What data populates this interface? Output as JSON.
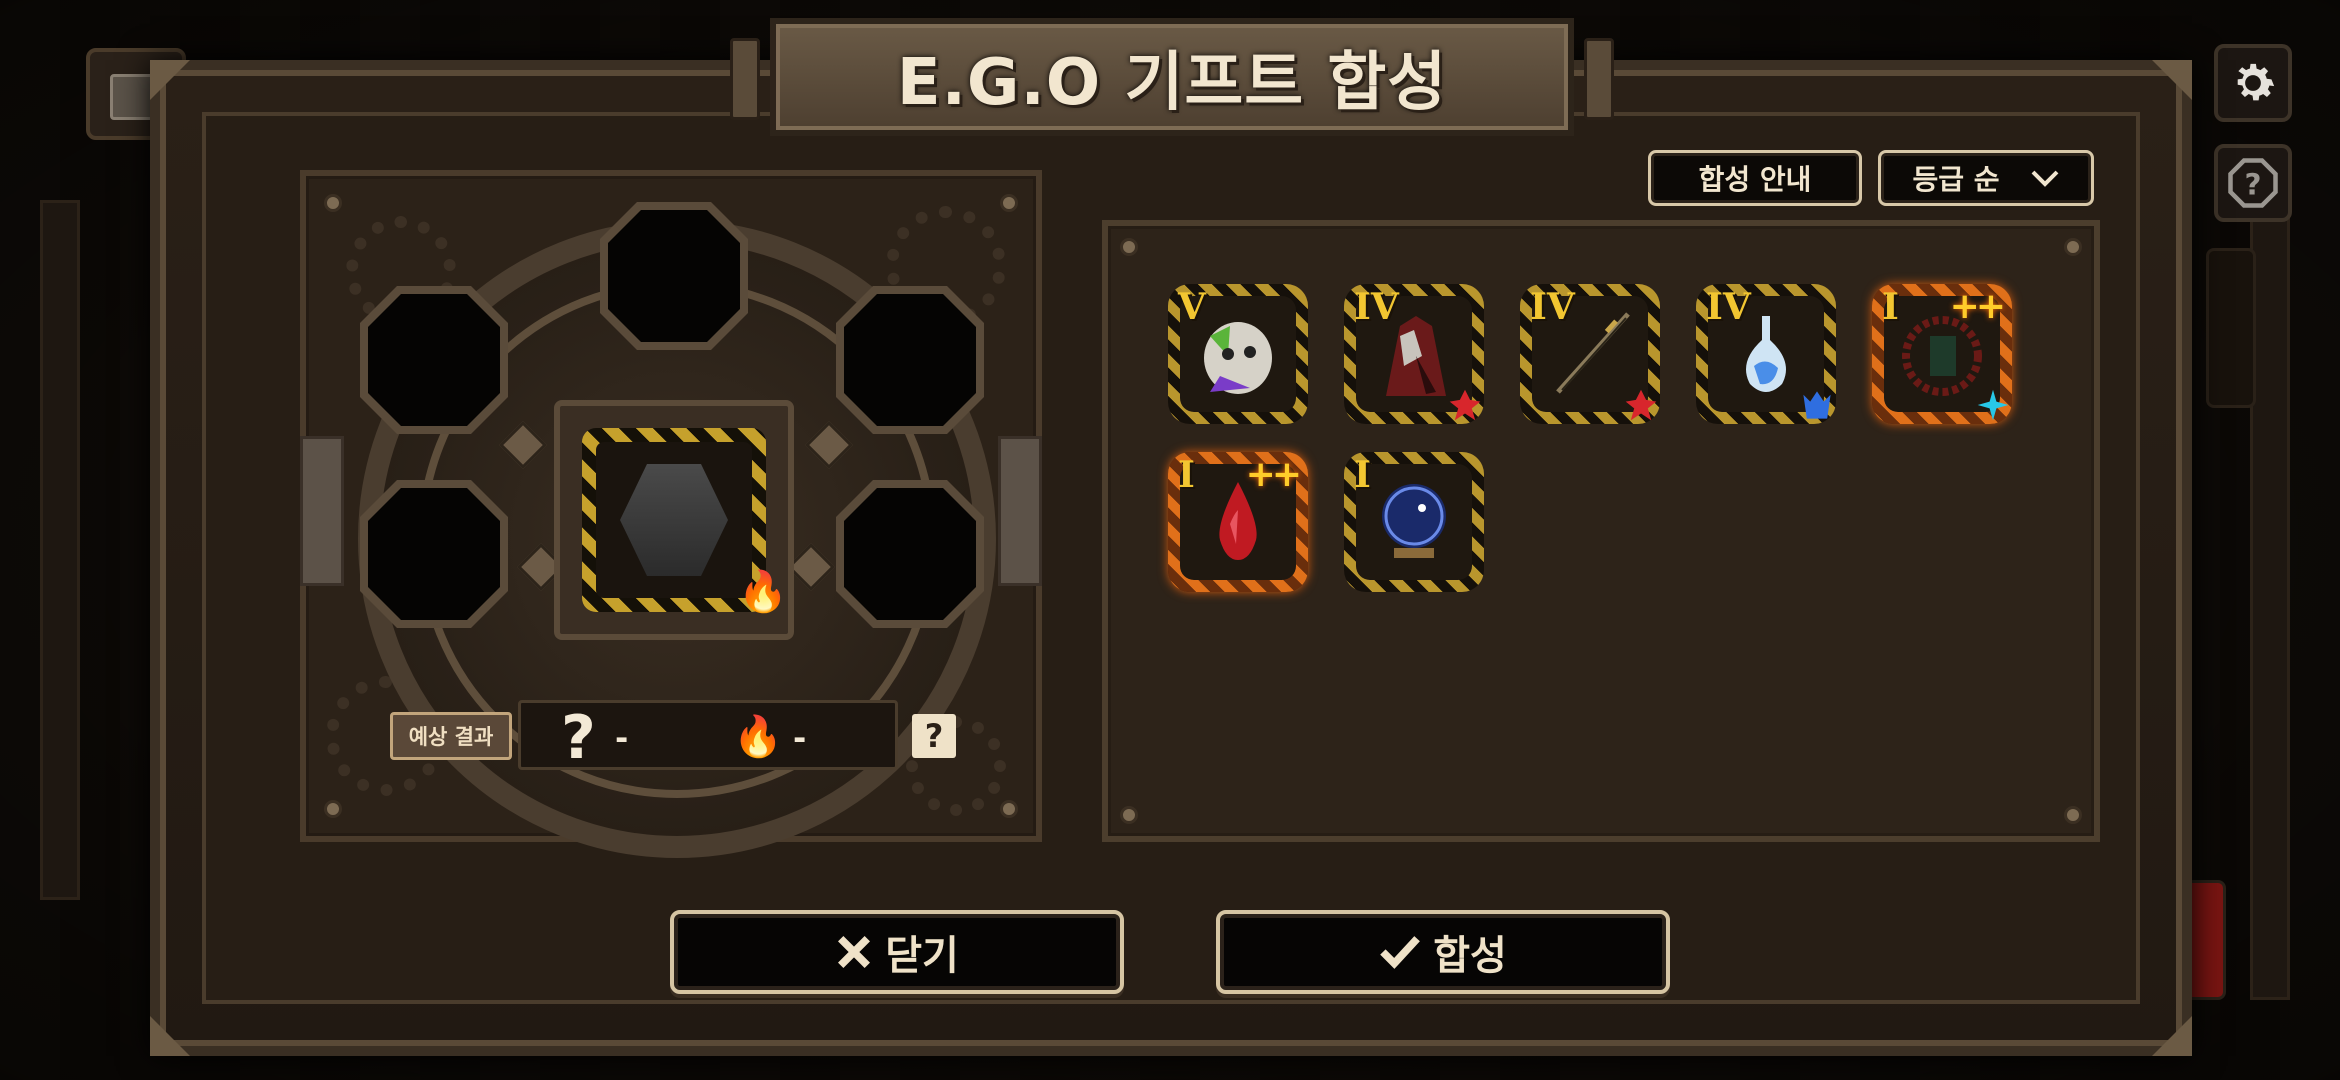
{
  "title": "E.G.O 기프트 합성",
  "buttons": {
    "guide": "합성 안내",
    "sort": "등급 순",
    "close": "닫기",
    "synthesize": "합성"
  },
  "expected_result": {
    "label": "예상 결과",
    "grade": "?",
    "grade_value": "-",
    "keyword_value": "-",
    "help": "?"
  },
  "gifts": [
    {
      "tier": "V",
      "plus": "",
      "affinity": "none",
      "frame": "gold"
    },
    {
      "tier": "IV",
      "plus": "",
      "affinity": "red",
      "frame": "gold"
    },
    {
      "tier": "IV",
      "plus": "",
      "affinity": "red",
      "frame": "gold"
    },
    {
      "tier": "IV",
      "plus": "",
      "affinity": "blue",
      "frame": "gold"
    },
    {
      "tier": "I",
      "plus": "++",
      "affinity": "cyan",
      "frame": "orange"
    },
    {
      "tier": "I",
      "plus": "++",
      "affinity": "none",
      "frame": "orange"
    },
    {
      "tier": "I",
      "plus": "",
      "affinity": "none",
      "frame": "gold"
    }
  ],
  "colors": {
    "accent_gold": "#f2c631",
    "frame_orange": "#e0701a",
    "affinity_red": "#d8262c",
    "affinity_blue": "#2f6ee0",
    "affinity_cyan": "#27c8e8"
  }
}
